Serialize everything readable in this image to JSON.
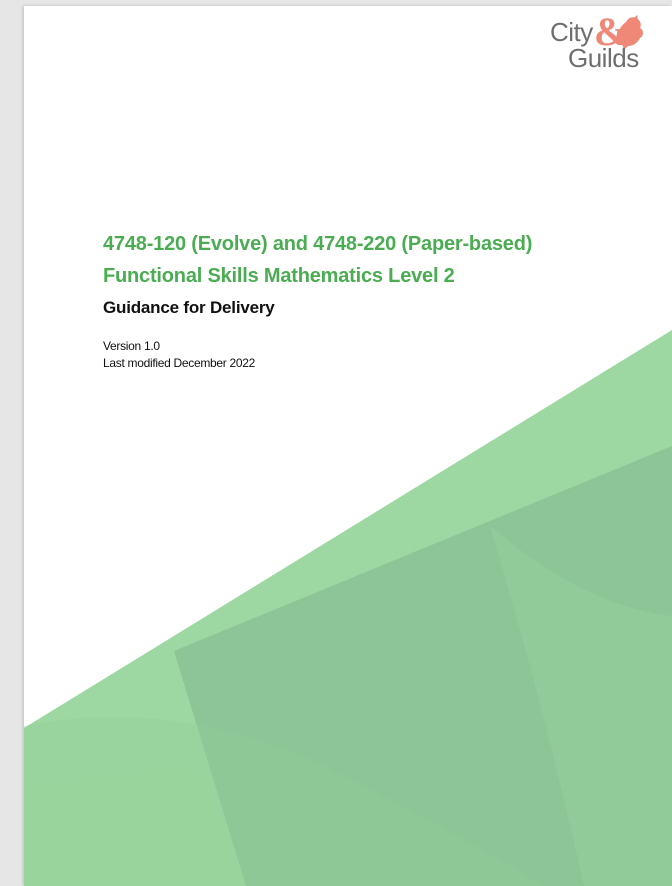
{
  "document": {
    "title_line_1": "4748-120 (Evolve) and 4748-220 (Paper-based)",
    "title_line_2": "Functional Skills Mathematics Level 2",
    "subtitle": "Guidance for Delivery",
    "version": "Version 1.0",
    "last_modified": "Last modified December 2022"
  },
  "logo": {
    "word_1": "City",
    "ampersand": "&",
    "word_2": "Guilds",
    "icon": "lion-icon"
  },
  "colors": {
    "title_green": "#4aad52",
    "logo_text": "#6f6f6f",
    "logo_accent": "#f08878",
    "shape_green_light": "#9bd6a0",
    "shape_green_mid": "#8cc796",
    "shape_green_dark": "#86bd93"
  }
}
